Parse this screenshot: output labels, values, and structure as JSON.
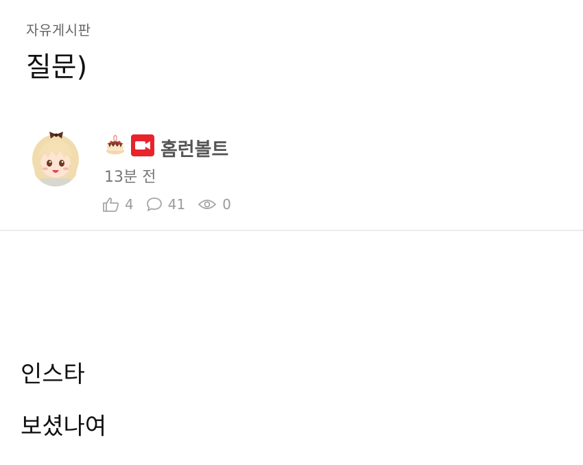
{
  "post": {
    "board_name": "자유게시판",
    "title": "질문)",
    "author": {
      "nickname": "홈런볼트",
      "time_ago": "13분 전",
      "badges": [
        "cake-rank-icon",
        "video-camera-icon"
      ]
    },
    "stats": {
      "likes": "4",
      "comments": "41",
      "views": "0"
    },
    "body_lines": [
      "인스타",
      "보셨나여"
    ]
  },
  "colors": {
    "video_badge": "#e8232b",
    "stat_gray": "#9a9a9a",
    "divider": "#ececec"
  }
}
